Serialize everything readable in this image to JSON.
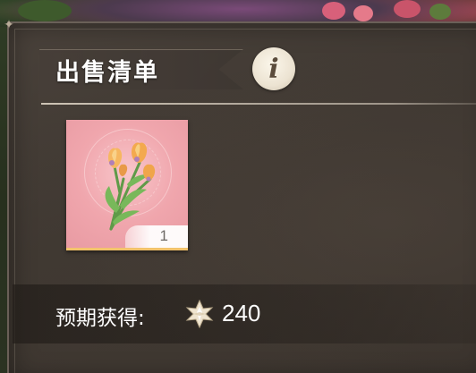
{
  "panel": {
    "title": "出售清单",
    "info_icon": "info-icon"
  },
  "item": {
    "icon": "tulip-bouquet-icon",
    "quantity": "1"
  },
  "earnings": {
    "label": "预期获得:",
    "currency_icon": "star-crystal-icon",
    "value": "240"
  },
  "colors": {
    "card_background": "#f0a6ad",
    "card_accent": "#f2c36c",
    "panel_background": "#3e3731",
    "text": "#ffffff"
  }
}
